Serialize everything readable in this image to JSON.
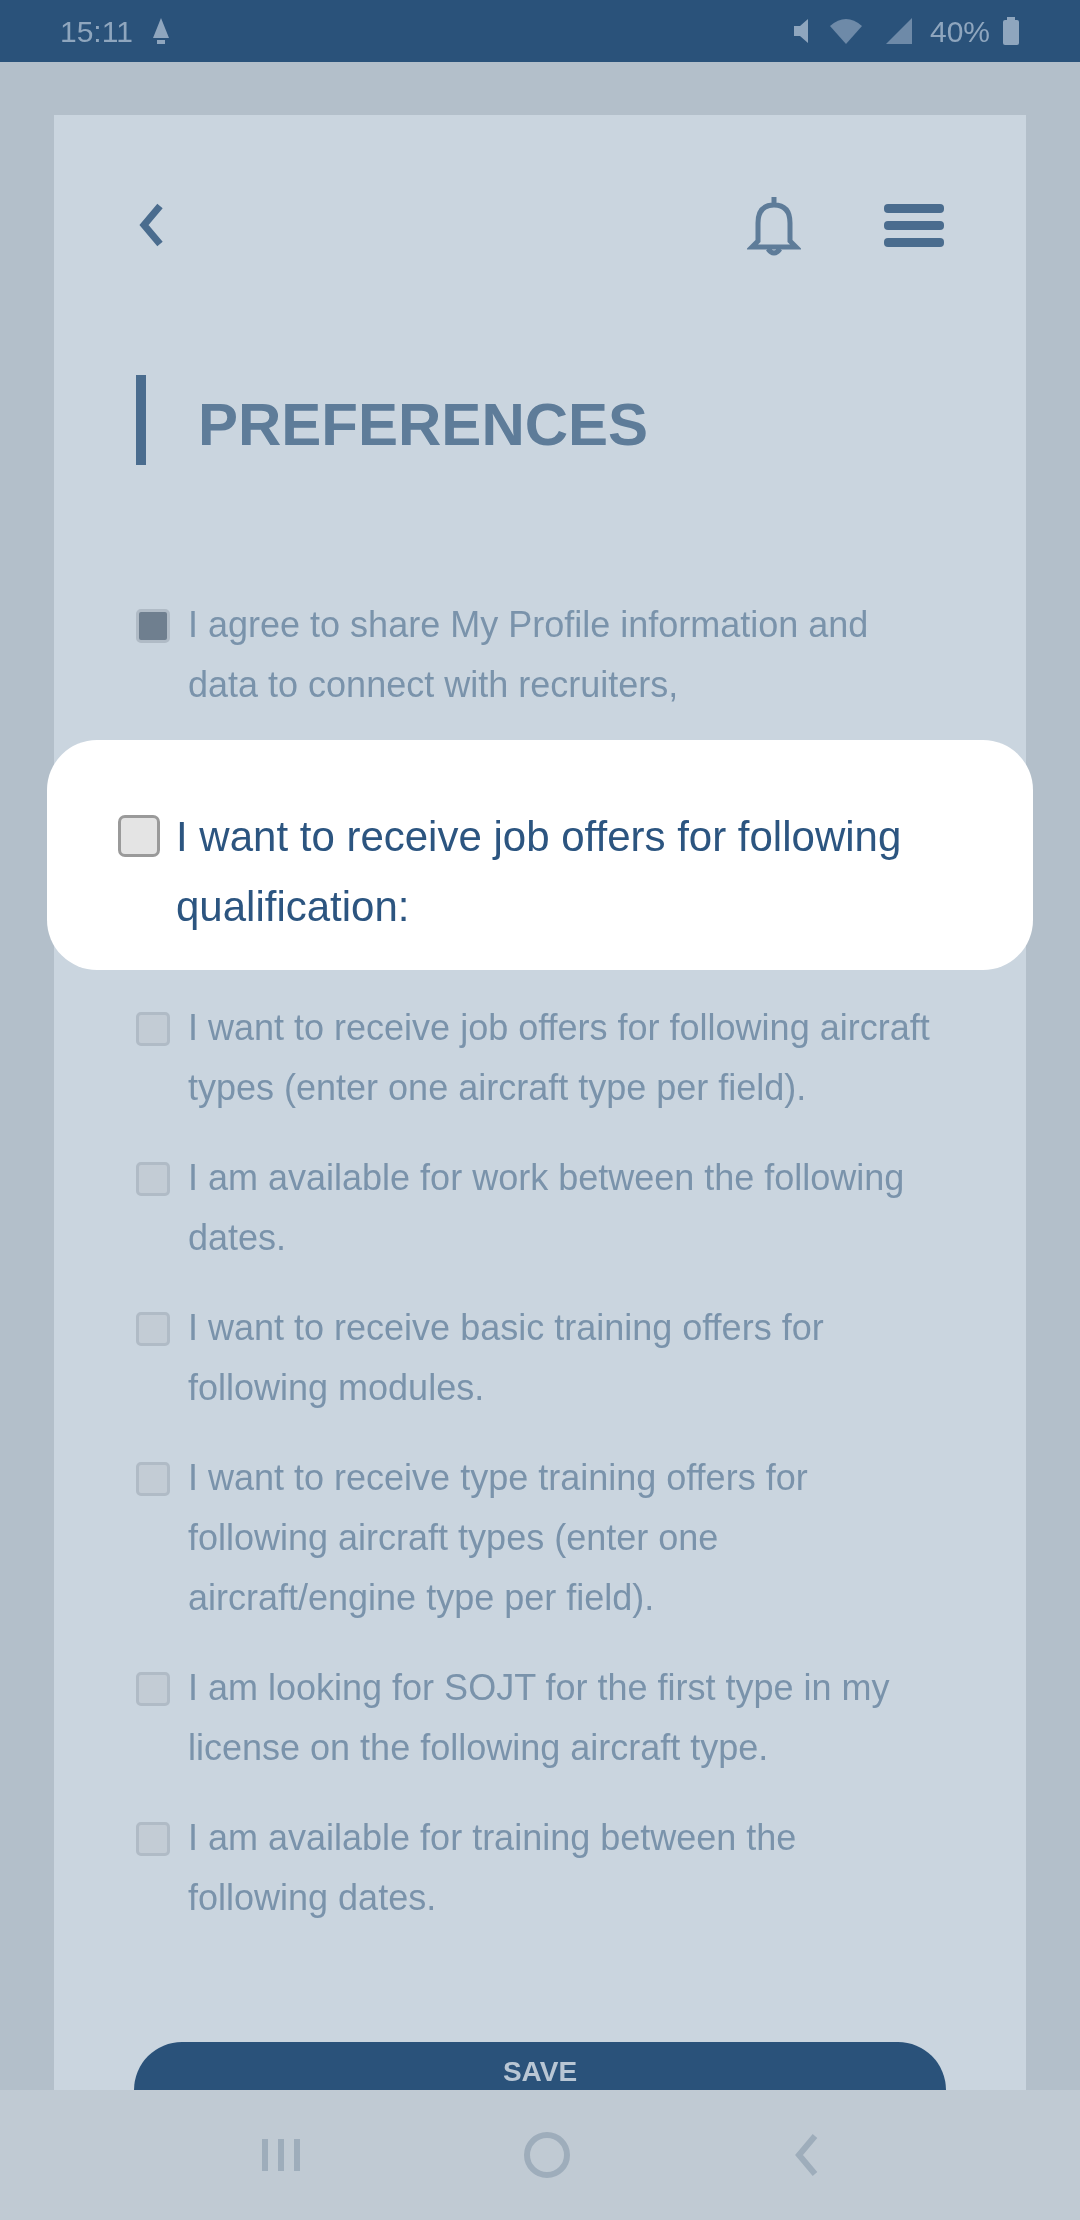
{
  "status_bar": {
    "time": "15:11",
    "battery": "40%"
  },
  "title": "PREFERENCES",
  "options": [
    {
      "kind": "dimmed",
      "text": "I agree to share My Profile information and data to connect with recruiters,",
      "checked": true
    },
    {
      "kind": "highlighted",
      "text": "I want to receive job offers for following qualification:",
      "checked": false
    },
    {
      "kind": "dimmed",
      "text": "I want to receive job offers for following aircraft types (enter one aircraft type per field).",
      "checked": false
    },
    {
      "kind": "dimmed",
      "text": "I am available for work between the following dates.",
      "checked": false
    },
    {
      "kind": "dimmed",
      "text": "I want to receive basic training offers for following modules.",
      "checked": false
    },
    {
      "kind": "dimmed",
      "text": "I want to receive type training offers for following aircraft types (enter one aircraft/engine type per field).",
      "checked": false
    },
    {
      "kind": "dimmed",
      "text": "I am looking for SOJT for the first type in my license on the following aircraft type.",
      "checked": false
    },
    {
      "kind": "dimmed",
      "text": "I am available for training between the following dates.",
      "checked": false
    }
  ],
  "save_button": "SAVE"
}
